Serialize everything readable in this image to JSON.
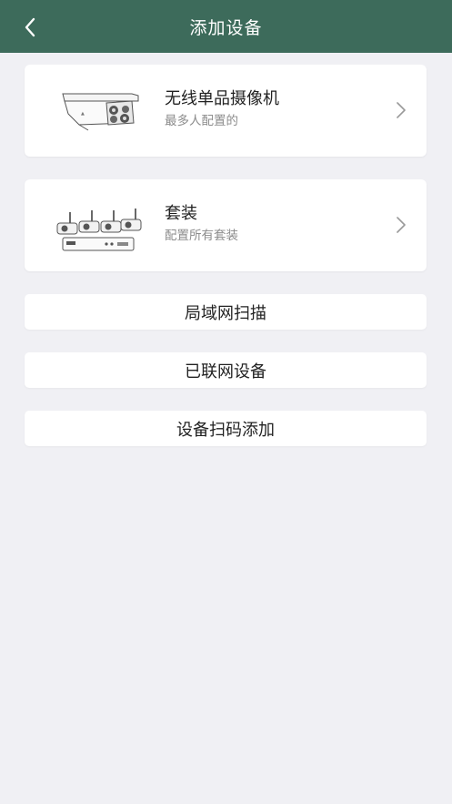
{
  "header": {
    "title": "添加设备",
    "back_icon": "chevron-left-icon",
    "bg_color": "#3d6b5b"
  },
  "cards": [
    {
      "title": "无线单品摄像机",
      "subtitle": "最多人配置的",
      "image": "bullet-camera-icon",
      "arrow": "chevron-right-icon"
    },
    {
      "title": "套装",
      "subtitle": "配置所有套装",
      "image": "nvr-camera-kit-icon",
      "arrow": "chevron-right-icon"
    }
  ],
  "buttons": {
    "lan_scan": "局域网扫描",
    "networked_devices": "已联网设备",
    "scan_code_add": "设备扫码添加"
  }
}
